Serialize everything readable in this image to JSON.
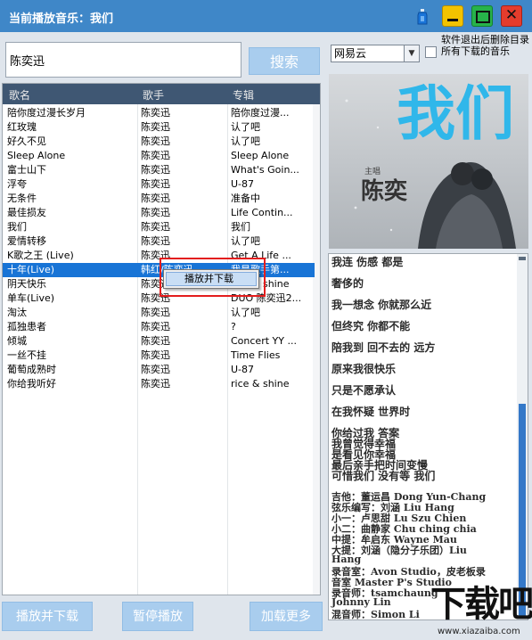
{
  "window": {
    "title": "当前播放音乐：我们"
  },
  "search": {
    "value": "陈奕迅",
    "button_label": "搜索"
  },
  "source": {
    "selected": "网易云"
  },
  "option": {
    "delete_on_exit_label": "软件退出后删除目录所有下载的音乐"
  },
  "table": {
    "columns": [
      "歌名",
      "歌手",
      "专辑"
    ],
    "rows": [
      [
        "陪你度过漫长岁月",
        "陈奕迅",
        "陪你度过漫..."
      ],
      [
        "红玫瑰",
        "陈奕迅",
        "认了吧"
      ],
      [
        "好久不见",
        "陈奕迅",
        "认了吧"
      ],
      [
        "Sleep Alone",
        "陈奕迅",
        "Sleep Alone"
      ],
      [
        "富士山下",
        "陈奕迅",
        "What's Goin..."
      ],
      [
        "浮夸",
        "陈奕迅",
        "U-87"
      ],
      [
        "无条件",
        "陈奕迅",
        "准备中"
      ],
      [
        "最佳损友",
        "陈奕迅",
        "Life Contin..."
      ],
      [
        "我们",
        "陈奕迅",
        "我们"
      ],
      [
        "爱情转移",
        "陈奕迅",
        "认了吧"
      ],
      [
        "K歌之王 (Live)",
        "陈奕迅",
        "Get A Life ..."
      ],
      [
        "十年(Live)",
        "韩红/陈奕迅",
        "我是歌手第..."
      ],
      [
        "阴天快乐",
        "陈奕迅",
        "rice & shine"
      ],
      [
        "单车(Live)",
        "陈奕迅",
        "DUO 陈奕迅2..."
      ],
      [
        "淘汰",
        "陈奕迅",
        "认了吧"
      ],
      [
        "孤独患者",
        "陈奕迅",
        "?"
      ],
      [
        "倾城",
        "陈奕迅",
        "Concert YY ..."
      ],
      [
        "一丝不挂",
        "陈奕迅",
        "Time Flies"
      ],
      [
        "葡萄成熟时",
        "陈奕迅",
        "U-87"
      ],
      [
        "你给我听好",
        "陈奕迅",
        "rice & shine"
      ]
    ],
    "selected_index": 11
  },
  "context_menu": {
    "item": "播放并下载"
  },
  "buttons": {
    "play_download": "播放并下载",
    "pause": "暂停播放",
    "load_more": "加载更多"
  },
  "album": {
    "title_text": "我们",
    "singer": "陈奕",
    "sub": "主唱"
  },
  "lyrics": {
    "lines": [
      "我连 伤感 都是",
      "奢侈的",
      "我一想念 你就那么近",
      "但终究 你都不能",
      "陪我到 回不去的 远方",
      "原来我很快乐",
      "只是不愿承认",
      "在我怀疑 世界时",
      "你给过我 答案",
      "我曾觉得幸福",
      "是看见你幸福",
      "最后亲手把时间变慢",
      "可惜我们 没有等 我们",
      "吉他：董运昌 Dong Yun-Chang",
      "弦乐编写：刘涵 Liu Hang",
      "小一：卢思甜 Lu Szu Chien",
      "小二：曲静家 Chu ching chia",
      "中提：牟启东 Wayne Mau",
      "大提：刘涵（隐分子乐团）Liu",
      "Hang",
      "录音室：Avon Studio，皮老板录",
      "音室 Master P's Studio",
      "录音师：tsamchaung",
      "Johnny Lin",
      "混音师：Simon Li"
    ]
  },
  "watermark": {
    "main": "下载吧",
    "sub": "www.xiazaiba.com"
  },
  "colors": {
    "titlebar": "#3f87c8",
    "button": "#a9cdee",
    "table_header": "#3f5773",
    "selection": "#1874d6",
    "album_text": "#30b7ea",
    "highlight_box": "#e31d1d"
  }
}
